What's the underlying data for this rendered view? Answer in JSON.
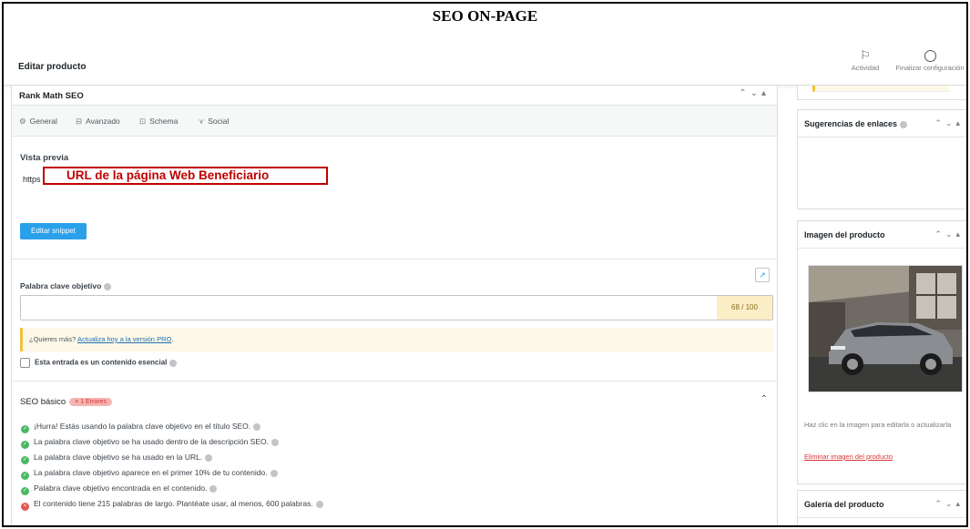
{
  "doc_title": "SEO ON-PAGE",
  "topbar": {
    "heading": "Editar producto",
    "activity_label": "Actividad",
    "finish_label": "Finalizar configuración"
  },
  "rankmath": {
    "title": "Rank Math SEO",
    "tabs": [
      "General",
      "Avanzado",
      "Schema",
      "Social"
    ],
    "preview_label": "Vista previa",
    "url_prefix": "https",
    "url_annotation": "URL de la página Web Beneficiario",
    "edit_snippet": "Editar snippet",
    "keyword_label": "Palabra clave objetivo",
    "keyword_value": "",
    "score": "68 / 100",
    "pro_notice_text": "¿Quieres más? ",
    "pro_link": "Actualiza hoy a la versión PRO",
    "pro_notice_end": ".",
    "pillar_label": "Esta entrada es un contenido esencial",
    "basic_seo_title": "SEO básico",
    "errors_badge": "× 1 Errores",
    "checks": [
      {
        "status": "ok",
        "text": "¡Hurra! Estás usando la palabra clave objetivo en el título SEO."
      },
      {
        "status": "ok",
        "text": "La palabra clave objetivo se ha usado dentro de la descripción SEO."
      },
      {
        "status": "ok",
        "text": "La palabra clave objetivo se ha usado en la URL."
      },
      {
        "status": "ok",
        "text": "La palabra clave objetivo aparece en el primer 10% de tu contenido."
      },
      {
        "status": "ok",
        "text": "Palabra clave objetivo encontrada en el contenido."
      },
      {
        "status": "error",
        "text": "El contenido tiene 215 palabras de largo. Plantéate usar, al menos, 600 palabras."
      }
    ]
  },
  "sidebar": {
    "link_suggestions_title": "Sugerencias de enlaces",
    "product_image_title": "Imagen del producto",
    "image_help": "Haz clic en la imagen para editarla o actualizarla",
    "remove_image": "Eliminar imagen del producto",
    "gallery_title": "Galería del producto"
  },
  "colors": {
    "accent_blue": "#2aa0ea",
    "annotation_red": "#c00000",
    "ok_green": "#4ab866",
    "error_red": "#e35950",
    "notice_yellow": "#f0c33c"
  }
}
